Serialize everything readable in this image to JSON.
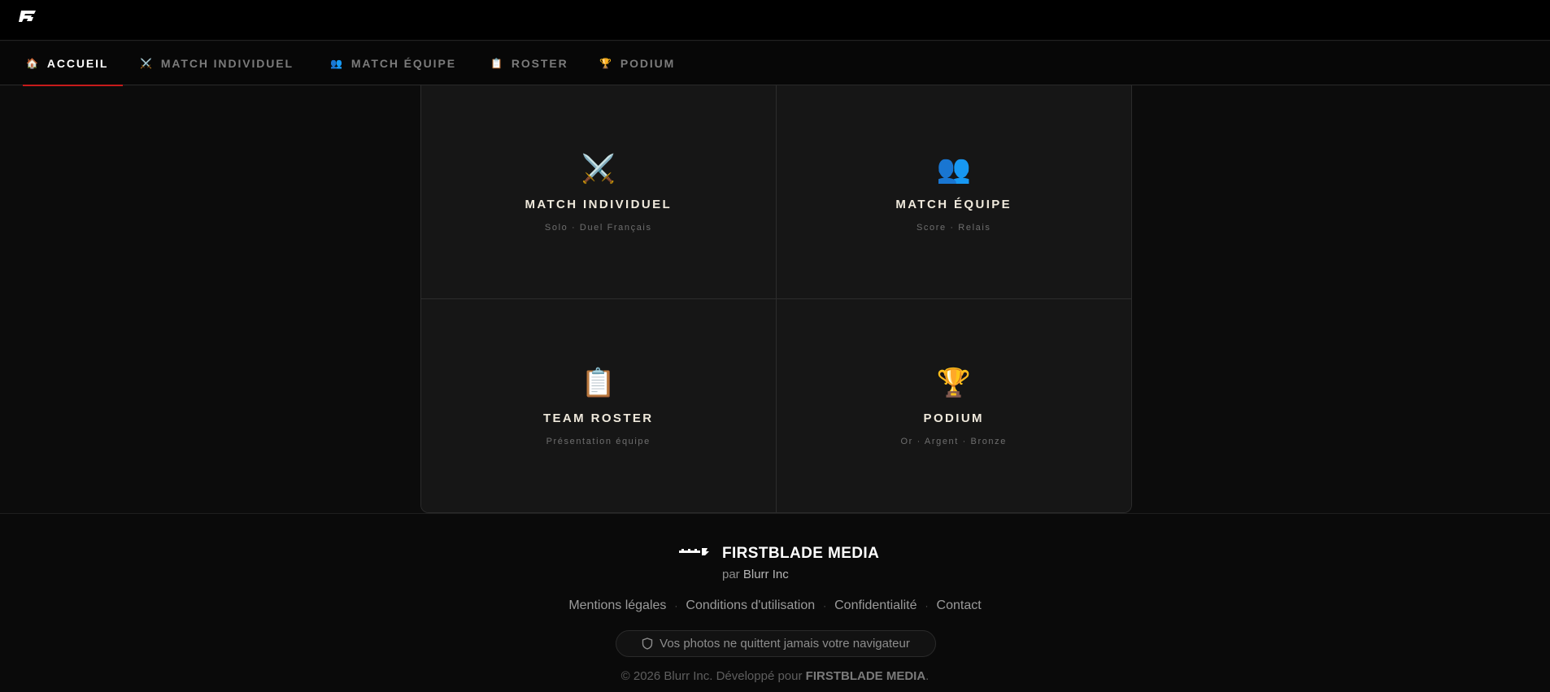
{
  "header": {
    "logo_icon": "firstblade-logo-icon"
  },
  "nav": {
    "items": [
      {
        "icon": "🏠",
        "label": "ACCUEIL",
        "active": true
      },
      {
        "icon": "⚔️",
        "label": "MATCH INDIVIDUEL"
      },
      {
        "icon": "👥",
        "label": "MATCH ÉQUIPE"
      },
      {
        "icon": "📋",
        "label": "ROSTER"
      },
      {
        "icon": "🏆",
        "label": "PODIUM"
      }
    ],
    "active_color": "#c71b1b"
  },
  "cards": [
    {
      "icon": "⚔️",
      "title": "MATCH INDIVIDUEL",
      "subtitle": "Solo · Duel Français"
    },
    {
      "icon": "👥",
      "title": "MATCH ÉQUIPE",
      "subtitle": "Score · Relais"
    },
    {
      "icon": "📋",
      "title": "TEAM ROSTER",
      "subtitle": "Présentation équipe"
    },
    {
      "icon": "🏆",
      "title": "PODIUM",
      "subtitle": "Or · Argent · Bronze"
    }
  ],
  "footer": {
    "brand_logo_icon": "blurr-logo-icon",
    "brand_name": "FIRSTBLADE MEDIA",
    "by_prefix": "par",
    "by_name": "Blurr Inc",
    "links": [
      "Mentions légales",
      "Conditions d'utilisation",
      "Confidentialité",
      "Contact"
    ],
    "separator": "·",
    "privacy_icon": "shield-icon",
    "privacy_note": "Vos photos ne quittent jamais votre navigateur",
    "copyright_prefix": "© 2026 Blurr Inc. Développé pour",
    "copyright_brand": "FIRSTBLADE MEDIA",
    "copyright_suffix": "."
  }
}
